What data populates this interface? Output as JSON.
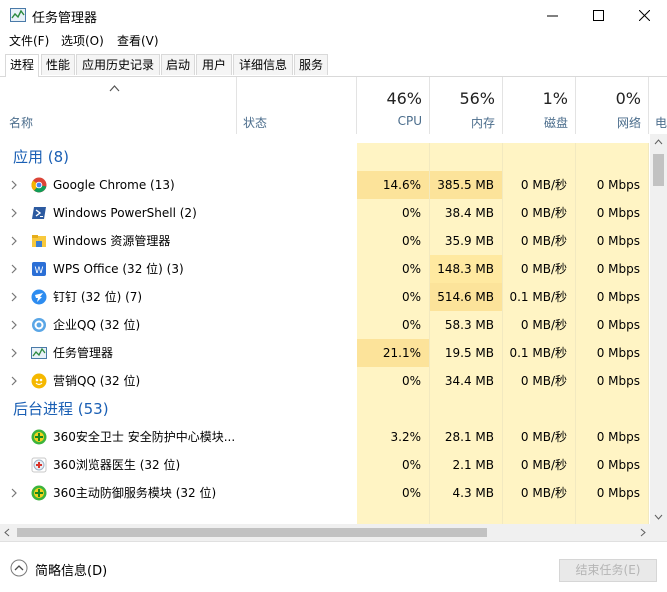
{
  "window": {
    "title": "任务管理器"
  },
  "menu": [
    "文件(F)",
    "选项(O)",
    "查看(V)"
  ],
  "tabs": [
    "进程",
    "性能",
    "应用历史记录",
    "启动",
    "用户",
    "详细信息",
    "服务"
  ],
  "columns": {
    "name": "名称",
    "status": "状态",
    "cpu": {
      "pct": "46%",
      "label": "CPU"
    },
    "memory": {
      "pct": "56%",
      "label": "内存"
    },
    "disk": {
      "pct": "1%",
      "label": "磁盘"
    },
    "network": {
      "pct": "0%",
      "label": "网络"
    },
    "power": {
      "label": "电"
    }
  },
  "groups": [
    {
      "title": "应用 (8)"
    },
    {
      "title": "后台进程 (53)"
    }
  ],
  "apps": [
    {
      "name": "Google Chrome (13)",
      "icon": "chrome-icon",
      "cpu": "14.6%",
      "mem": "385.5 MB",
      "disk": "0 MB/秒",
      "net": "0 Mbps"
    },
    {
      "name": "Windows PowerShell (2)",
      "icon": "powershell-icon",
      "cpu": "0%",
      "mem": "38.4 MB",
      "disk": "0 MB/秒",
      "net": "0 Mbps"
    },
    {
      "name": "Windows 资源管理器",
      "icon": "explorer-icon",
      "cpu": "0%",
      "mem": "35.9 MB",
      "disk": "0 MB/秒",
      "net": "0 Mbps"
    },
    {
      "name": "WPS Office (32 位) (3)",
      "icon": "wps-icon",
      "cpu": "0%",
      "mem": "148.3 MB",
      "disk": "0 MB/秒",
      "net": "0 Mbps"
    },
    {
      "name": "钉钉 (32 位) (7)",
      "icon": "dingtalk-icon",
      "cpu": "0%",
      "mem": "514.6 MB",
      "disk": "0.1 MB/秒",
      "net": "0 Mbps"
    },
    {
      "name": "企业QQ (32 位)",
      "icon": "qq-icon",
      "cpu": "0%",
      "mem": "58.3 MB",
      "disk": "0 MB/秒",
      "net": "0 Mbps"
    },
    {
      "name": "任务管理器",
      "icon": "task-manager-icon",
      "cpu": "21.1%",
      "mem": "19.5 MB",
      "disk": "0.1 MB/秒",
      "net": "0 Mbps"
    },
    {
      "name": "营销QQ (32 位)",
      "icon": "marketing-qq-icon",
      "cpu": "0%",
      "mem": "34.4 MB",
      "disk": "0 MB/秒",
      "net": "0 Mbps"
    }
  ],
  "background": [
    {
      "name": "360安全卫士 安全防护中心模块...",
      "icon": "360-safe-icon",
      "cpu": "3.2%",
      "mem": "28.1 MB",
      "disk": "0 MB/秒",
      "net": "0 Mbps"
    },
    {
      "name": "360浏览器医生 (32 位)",
      "icon": "360-doctor-icon",
      "cpu": "0%",
      "mem": "2.1 MB",
      "disk": "0 MB/秒",
      "net": "0 Mbps"
    },
    {
      "name": "360主动防御服务模块 (32 位)",
      "icon": "360-defense-icon",
      "cpu": "0%",
      "mem": "4.3 MB",
      "disk": "0 MB/秒",
      "net": "0 Mbps"
    }
  ],
  "footer": {
    "fewer_details": "简略信息(D)",
    "end_task": "结束任务(E)"
  },
  "colors": {
    "heat_light": "#fff4c4",
    "heat_mid": "#ffe9a0",
    "heat_strong": "#fce39a",
    "group_text": "#1a5fb4"
  }
}
